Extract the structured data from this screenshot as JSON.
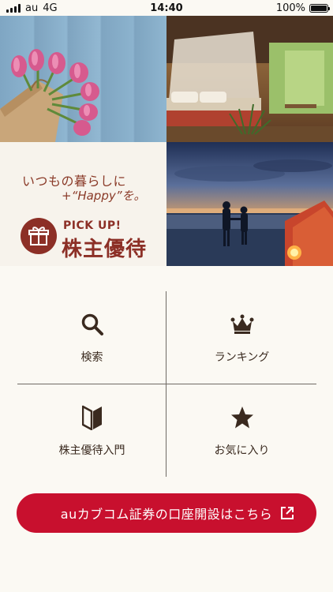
{
  "status_bar": {
    "carrier": "au",
    "network": "4G",
    "time": "14:40",
    "battery": "100%"
  },
  "promo": {
    "tagline_line1": "いつもの暮らしに",
    "tagline_line2": "+“Happy”を。",
    "pickup": "PICK UP!",
    "title": "株主優待"
  },
  "menu": {
    "items": [
      {
        "label": "検索",
        "icon": "search-icon"
      },
      {
        "label": "ランキング",
        "icon": "crown-icon"
      },
      {
        "label": "株主優待入門",
        "icon": "beginner-mark-icon"
      },
      {
        "label": "お気に入り",
        "icon": "star-icon"
      }
    ]
  },
  "cta": {
    "label": "auカブコム証券の口座開設はこちら",
    "icon": "external-link-icon"
  },
  "colors": {
    "background": "#fbf9f3",
    "accent_red": "#c8102e",
    "promo_brown": "#8c2f26",
    "icon_dark": "#3a2a1f"
  }
}
